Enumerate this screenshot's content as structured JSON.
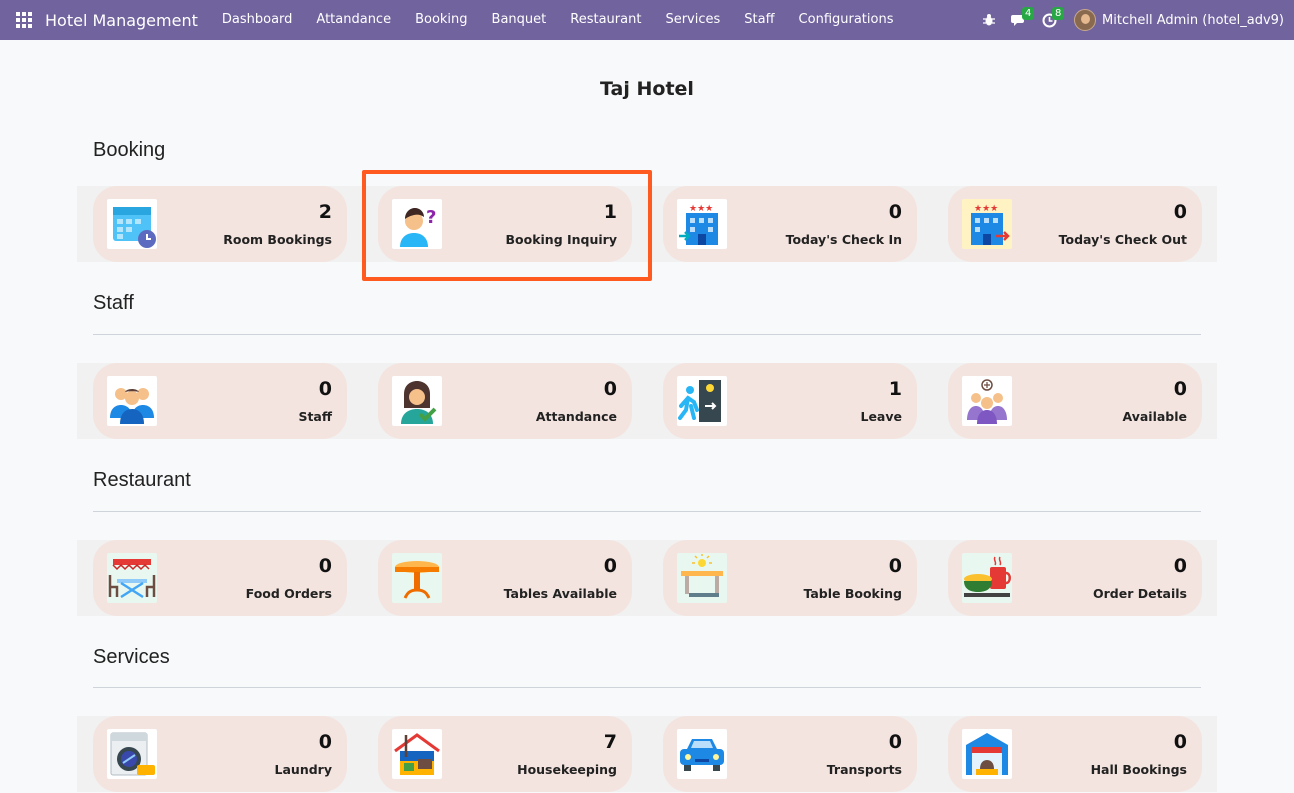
{
  "nav": {
    "brand": "Hotel Management",
    "menu": [
      "Dashboard",
      "Attandance",
      "Booking",
      "Banquet",
      "Restaurant",
      "Services",
      "Staff",
      "Configurations"
    ],
    "messages_badge": "4",
    "activities_badge": "8",
    "user": "Mitchell Admin (hotel_adv9)"
  },
  "page": {
    "title": "Taj Hotel"
  },
  "sections": {
    "booking": {
      "title": "Booking",
      "cards": [
        {
          "value": "2",
          "label": "Room Bookings",
          "icon": "calendar-clock-icon"
        },
        {
          "value": "1",
          "label": "Booking Inquiry",
          "icon": "person-question-icon"
        },
        {
          "value": "0",
          "label": "Today's Check In",
          "icon": "hotel-checkin-icon"
        },
        {
          "value": "0",
          "label": "Today's Check Out",
          "icon": "hotel-checkout-icon"
        }
      ]
    },
    "staff": {
      "title": "Staff",
      "cards": [
        {
          "value": "0",
          "label": "Staff",
          "icon": "team-icon"
        },
        {
          "value": "0",
          "label": "Attandance",
          "icon": "person-check-icon"
        },
        {
          "value": "1",
          "label": "Leave",
          "icon": "exit-door-icon"
        },
        {
          "value": "0",
          "label": "Available",
          "icon": "people-available-icon"
        }
      ]
    },
    "restaurant": {
      "title": "Restaurant",
      "cards": [
        {
          "value": "0",
          "label": "Food Orders",
          "icon": "dining-table-icon"
        },
        {
          "value": "0",
          "label": "Tables Available",
          "icon": "round-table-icon"
        },
        {
          "value": "0",
          "label": "Table Booking",
          "icon": "reserved-table-icon"
        },
        {
          "value": "0",
          "label": "Order Details",
          "icon": "food-tray-icon"
        }
      ]
    },
    "services": {
      "title": "Services",
      "cards": [
        {
          "value": "0",
          "label": "Laundry",
          "icon": "washing-machine-icon"
        },
        {
          "value": "7",
          "label": "Housekeeping",
          "icon": "housekeeping-icon"
        },
        {
          "value": "0",
          "label": "Transports",
          "icon": "car-icon"
        },
        {
          "value": "0",
          "label": "Hall Bookings",
          "icon": "hall-icon"
        }
      ]
    }
  },
  "colors": {
    "navbar": "#71639e",
    "card": "#f4e4df",
    "highlight": "#ff5a1f"
  }
}
